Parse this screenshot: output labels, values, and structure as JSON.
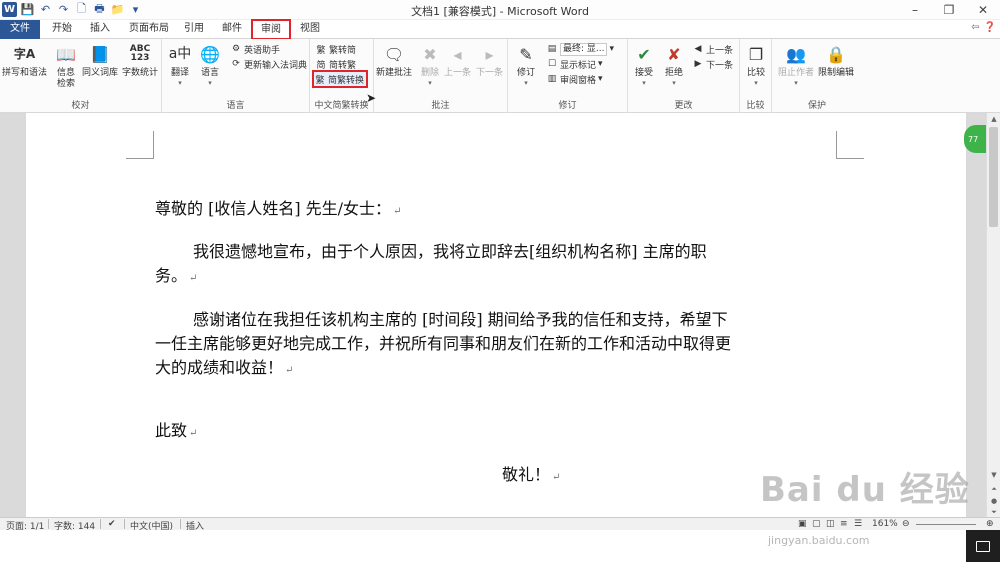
{
  "window": {
    "title": "文档1 [兼容模式] - Microsoft Word"
  },
  "tabs": [
    {
      "label": "文件"
    },
    {
      "label": "开始"
    },
    {
      "label": "插入"
    },
    {
      "label": "页面布局"
    },
    {
      "label": "引用"
    },
    {
      "label": "邮件"
    },
    {
      "label": "审阅"
    },
    {
      "label": "视图"
    }
  ],
  "ribbon": {
    "proofing": {
      "label": "校对",
      "spelling": "拼写和语法",
      "info": "信息",
      "info2": "检索",
      "thesaurus": "同义词库",
      "wordcount": "字数统计"
    },
    "language": {
      "label": "语言",
      "translate": "翻译",
      "language": "语言",
      "english_assist": "英语助手",
      "update_ime": "更新输入法词典"
    },
    "chinese": {
      "label": "中文简繁转换",
      "to_simplified": "繁转简",
      "to_traditional": "简转繁",
      "convert": "简繁转换"
    },
    "comments": {
      "label": "批注",
      "new": "新建批注",
      "delete": "删除",
      "prev": "上一条",
      "next": "下一条"
    },
    "tracking": {
      "label": "修订",
      "track": "修订",
      "final": "最终: 显...",
      "show_markup": "显示标记",
      "pane": "审阅窗格"
    },
    "changes": {
      "label": "更改",
      "accept": "接受",
      "reject": "拒绝",
      "prev": "上一条",
      "next": "下一条"
    },
    "compare": {
      "label": "比较",
      "compare": "比较"
    },
    "protect": {
      "label": "保护",
      "block_authors": "阻止作者",
      "restrict": "限制编辑"
    }
  },
  "document": {
    "salutation": "尊敬的 [收信人姓名] 先生/女士：",
    "para1_l1": "我很遗憾地宣布，由于个人原因，我将立即辞去[组织机构名称] 主席的职",
    "para1_l2": "务。",
    "para2_l1": "感谢诸位在我担任该机构主席的 [时间段] 期间给予我的信任和支持，希望下",
    "para2_l2": "一任主席能够更好地完成工作，并祝所有同事和朋友们在新的工作和活动中取得更",
    "para2_l3": "大的成绩和收益！",
    "closing1": "此致",
    "closing2": "敬礼！",
    "para_mark": "↵",
    "side_badge": "77"
  },
  "statusbar": {
    "page": "页面: 1/1",
    "words": "字数: 144",
    "language": "中文(中国)",
    "mode": "插入",
    "zoom": "161%"
  },
  "watermark": {
    "brand": "Bai du 经验",
    "url": "jingyan.baidu.com"
  },
  "colors": {
    "file_tab": "#2b5797",
    "highlight": "#e0252a",
    "status_bg": "#f1f1f1"
  }
}
